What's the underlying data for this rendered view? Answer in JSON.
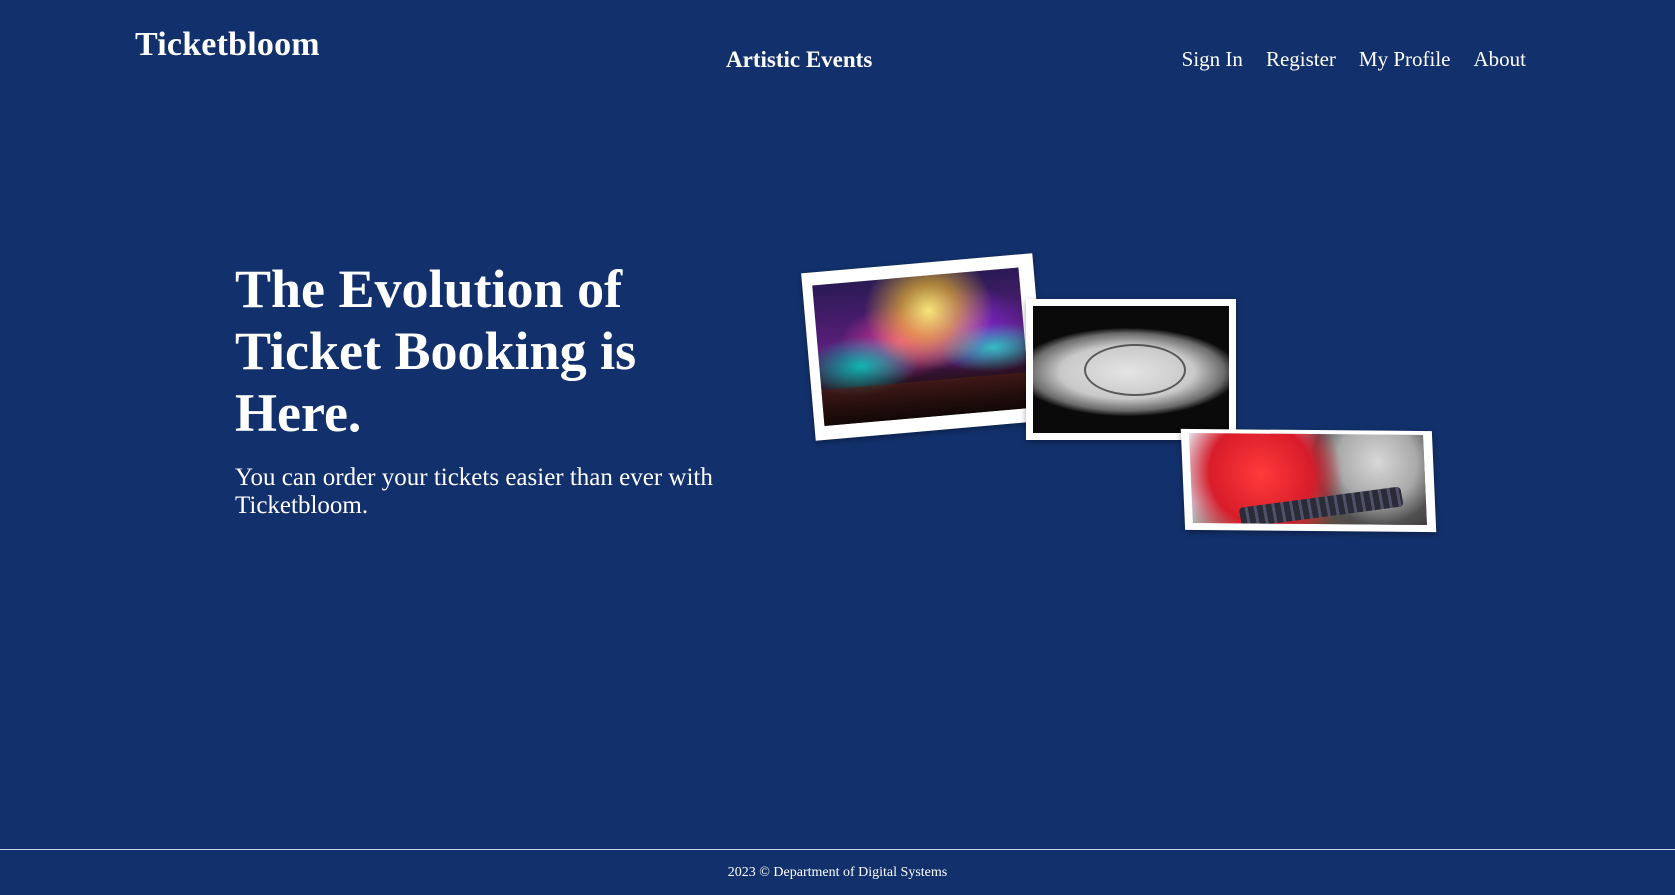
{
  "header": {
    "brand": "Ticketbloom",
    "center_title": "Artistic Events",
    "nav": [
      {
        "label": "Sign In"
      },
      {
        "label": "Register"
      },
      {
        "label": "My Profile"
      },
      {
        "label": "About"
      }
    ]
  },
  "hero": {
    "title": "The Evolution of Ticket Booking is Here.",
    "subtitle": "You can order your tickets easier than ever with Ticketbloom."
  },
  "footer": {
    "text": "2023 © Department of Digital Systems"
  },
  "colors": {
    "background": "#12306b",
    "text": "#ffffff"
  }
}
